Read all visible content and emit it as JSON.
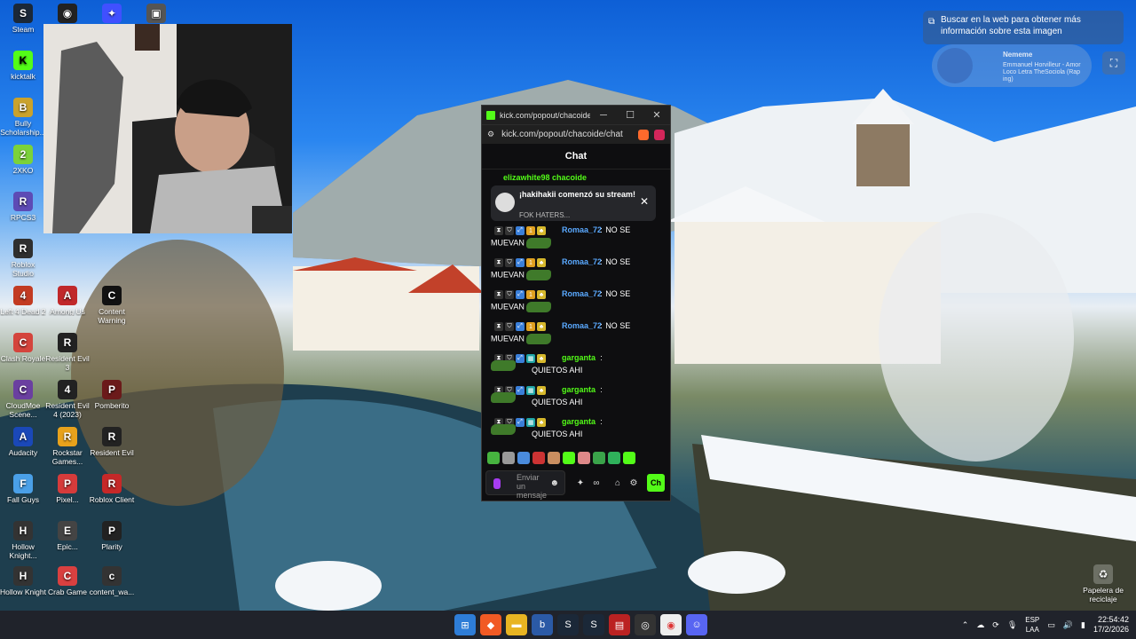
{
  "desktop_icons": [
    {
      "label": "Steam",
      "color": "#1b2838",
      "glyph": "S"
    },
    {
      "label": "kicktalk",
      "color": "#53fc18",
      "glyph": "K"
    },
    {
      "label": "Bully Scholarship...",
      "color": "#caa22c",
      "glyph": "B"
    },
    {
      "label": "2XKO",
      "color": "#7bd23a",
      "glyph": "2"
    },
    {
      "label": "RPCS3",
      "color": "#5d4bb5",
      "glyph": "R"
    },
    {
      "label": "Roblox Studio",
      "color": "#2f2f2f",
      "glyph": "R"
    },
    {
      "label": "Left 4 Dead 2",
      "color": "#c23b22",
      "glyph": "4"
    },
    {
      "label": "Clash Royale",
      "color": "#d4443c",
      "glyph": "C"
    },
    {
      "label": "CloudMoe Scene...",
      "color": "#6a3fa0",
      "glyph": "C"
    },
    {
      "label": "Audacity",
      "color": "#1a48b8",
      "glyph": "A"
    },
    {
      "label": "Fall Guys",
      "color": "#4aa0e8",
      "glyph": "F"
    },
    {
      "label": "Hollow Knight...",
      "color": "#333",
      "glyph": "H"
    },
    {
      "label": "Hollow Knight",
      "color": "#333",
      "glyph": "H"
    },
    {
      "label": "Among Us",
      "color": "#c0282a",
      "glyph": "A"
    },
    {
      "label": "Resident Evil 3",
      "color": "#222",
      "glyph": "R"
    },
    {
      "label": "Resident Evil 4 (2023)",
      "color": "#222",
      "glyph": "4"
    },
    {
      "label": "Rockstar Games...",
      "color": "#e8a21c",
      "glyph": "R"
    },
    {
      "label": "Pixel...",
      "color": "#d63b3b",
      "glyph": "P"
    },
    {
      "label": "Epic...",
      "color": "#444",
      "glyph": "E"
    },
    {
      "label": "Crab Game",
      "color": "#d94040",
      "glyph": "C"
    },
    {
      "label": "Content Warning",
      "color": "#111",
      "glyph": "C"
    },
    {
      "label": "Pomberito",
      "color": "#6b1a1a",
      "glyph": "P"
    },
    {
      "label": "Resident Evil",
      "color": "#222",
      "glyph": "R"
    },
    {
      "label": "Roblox Client",
      "color": "#c62828",
      "glyph": "R"
    },
    {
      "label": "Plarity",
      "color": "#222",
      "glyph": "P"
    },
    {
      "label": "content_wa...",
      "color": "#333",
      "glyph": "c"
    },
    {
      "label": "Papelera de reciclaje",
      "color": "#9ab",
      "glyph": "♻"
    }
  ],
  "overlay": {
    "search_text": "Buscar en la web para obtener más información sobre esta imagen",
    "now_playing_title": "Nememe",
    "now_playing_sub": "Emmanuel Horvilleur - Amor Loco Letra TheSociola (Rap ing)"
  },
  "chat_window": {
    "title": "kick.com/popout/chacoide/...",
    "url": "kick.com/popout/chacoide/chat",
    "header": "Chat",
    "behind_text": "elizawhite98  chacoide",
    "pinned_text": "¡hakihakii comenzó su stream!",
    "pinned_sub": "FOK HATERS...",
    "messages": [
      {
        "user": "Romaa_72",
        "color": "#5aa9ff",
        "text": "NO SE",
        "text2": "MUEVAN"
      },
      {
        "user": "Romaa_72",
        "color": "#5aa9ff",
        "text": "NO SE",
        "text2": "MUEVAN"
      },
      {
        "user": "Romaa_72",
        "color": "#5aa9ff",
        "text": "NO SE",
        "text2": "MUEVAN"
      },
      {
        "user": "Romaa_72",
        "color": "#5aa9ff",
        "text": "NO SE",
        "text2": "MUEVAN"
      },
      {
        "user": "garganta",
        "color": "#53fc18",
        "text": "",
        "text2": "QUIETOS AHI"
      },
      {
        "user": "garganta",
        "color": "#53fc18",
        "text": "",
        "text2": "QUIETOS AHI"
      },
      {
        "user": "garganta",
        "color": "#53fc18",
        "text": "",
        "text2": "QUIETOS AHI"
      }
    ],
    "input_placeholder": "Enviar un mensaje",
    "send_label": "Ch"
  },
  "taskbar": {
    "lang_top": "ESP",
    "lang_bottom": "LAA",
    "time": "22:54:42",
    "date": "17/2/2026"
  }
}
